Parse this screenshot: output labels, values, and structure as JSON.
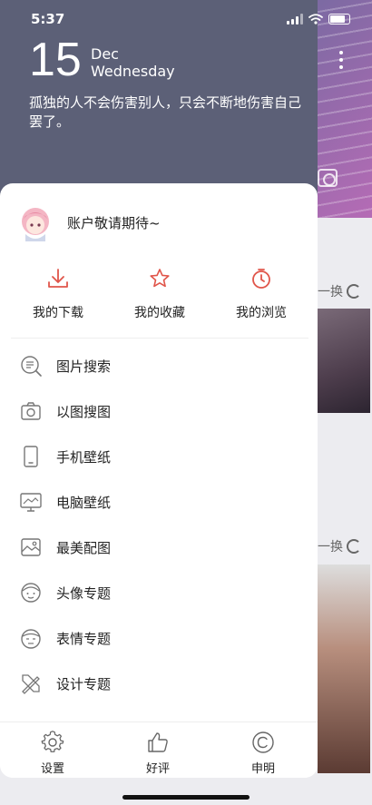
{
  "status_bar": {
    "time": "5:37"
  },
  "header": {
    "day": "15",
    "month": "Dec",
    "weekday": "Wednesday",
    "quote": "孤独的人不会伤害别人，只会不断地伤害自己罢了。"
  },
  "account": {
    "name": "账户敬请期待~",
    "avatar_icon": "anime-avatar-icon"
  },
  "quick_actions": [
    {
      "label": "我的下载",
      "icon": "download-icon"
    },
    {
      "label": "我的收藏",
      "icon": "star-icon"
    },
    {
      "label": "我的浏览",
      "icon": "history-icon"
    }
  ],
  "menu": [
    {
      "label": "图片搜索",
      "icon": "image-search-icon"
    },
    {
      "label": "以图搜图",
      "icon": "camera-icon"
    },
    {
      "label": "手机壁纸",
      "icon": "phone-icon"
    },
    {
      "label": "电脑壁纸",
      "icon": "monitor-icon"
    },
    {
      "label": "最美配图",
      "icon": "picture-icon"
    },
    {
      "label": "头像专题",
      "icon": "face-icon"
    },
    {
      "label": "表情专题",
      "icon": "emoji-icon"
    },
    {
      "label": "设计专题",
      "icon": "design-tools-icon"
    }
  ],
  "bottom_bar": [
    {
      "label": "设置",
      "icon": "gear-icon"
    },
    {
      "label": "好评",
      "icon": "thumbs-up-icon"
    },
    {
      "label": "申明",
      "icon": "copyright-icon"
    }
  ],
  "background": {
    "change_label": "一换"
  },
  "colors": {
    "accent": "#e0554a",
    "header_bg": "#5c6077",
    "icon_gray": "#777777"
  }
}
